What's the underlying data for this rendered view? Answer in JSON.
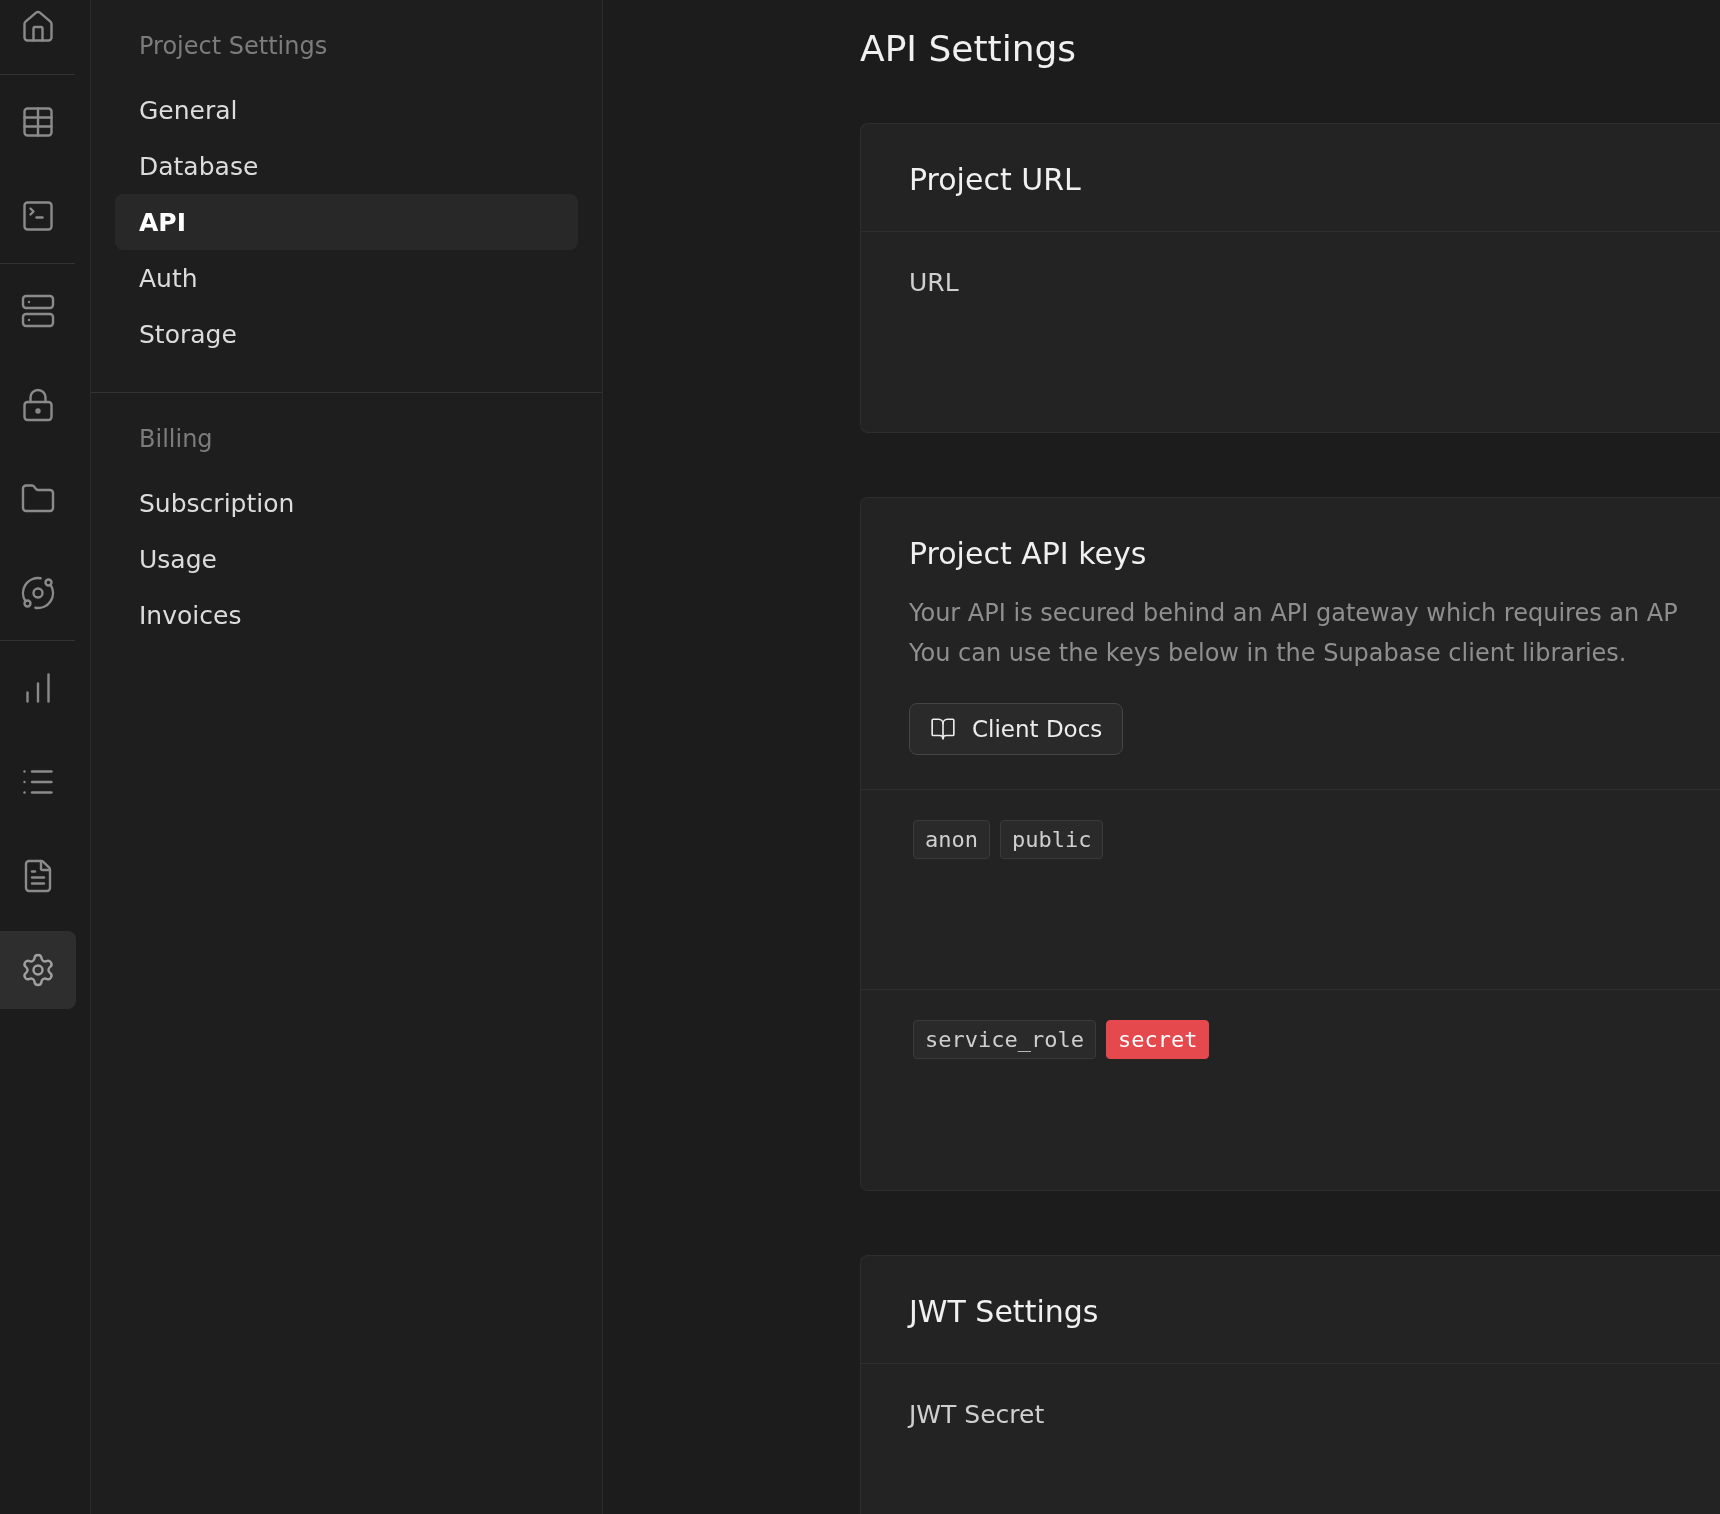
{
  "rail": {
    "groups": [
      [
        {
          "selected": false
        }
      ],
      [
        {
          "selected": false
        },
        {
          "selected": false
        }
      ],
      [
        {
          "selected": false
        },
        {
          "selected": false
        },
        {
          "selected": false
        },
        {
          "selected": false
        }
      ],
      [
        {
          "selected": false
        },
        {
          "selected": false
        },
        {
          "selected": false
        },
        {
          "selected": true
        }
      ]
    ]
  },
  "sidebar": {
    "sections": [
      {
        "title": "Project Settings",
        "items": [
          {
            "label": "General",
            "selected": false
          },
          {
            "label": "Database",
            "selected": false
          },
          {
            "label": "API",
            "selected": true
          },
          {
            "label": "Auth",
            "selected": false
          },
          {
            "label": "Storage",
            "selected": false
          }
        ]
      },
      {
        "title": "Billing",
        "items": [
          {
            "label": "Subscription",
            "selected": false
          },
          {
            "label": "Usage",
            "selected": false
          },
          {
            "label": "Invoices",
            "selected": false
          }
        ]
      }
    ]
  },
  "page": {
    "title": "API Settings",
    "cards": [
      {
        "title": "Project URL",
        "rows": [
          {
            "kind": "label",
            "label": "URL"
          }
        ]
      },
      {
        "title": "Project API keys",
        "description": [
          "Your API is secured behind an API gateway which requires an AP",
          "You can use the keys below in the Supabase client libraries."
        ],
        "button": "Client Docs",
        "rows": [
          {
            "kind": "tags",
            "tags": [
              {
                "text": "anon",
                "kind": "plain"
              },
              {
                "text": "public",
                "kind": "plain"
              }
            ]
          },
          {
            "kind": "tags",
            "tags": [
              {
                "text": "service_role",
                "kind": "plain"
              },
              {
                "text": "secret",
                "kind": "danger"
              }
            ]
          }
        ]
      },
      {
        "title": "JWT Settings",
        "rows": [
          {
            "kind": "label",
            "label": "JWT Secret"
          }
        ]
      }
    ]
  }
}
